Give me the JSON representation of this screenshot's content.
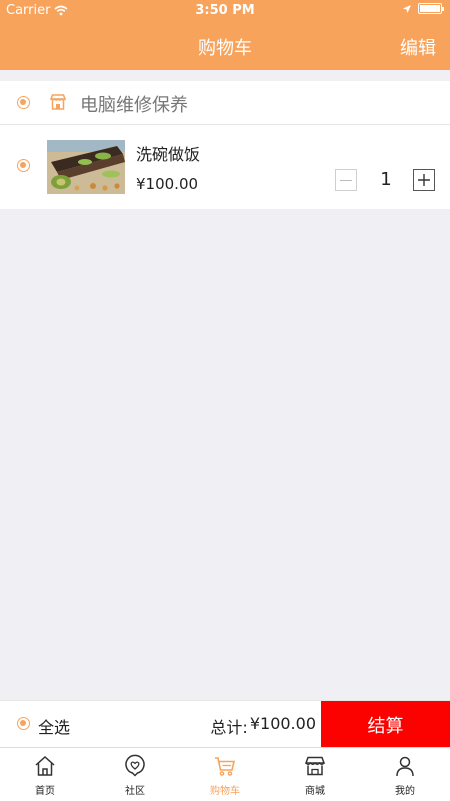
{
  "colors": {
    "accent": "#f7a35c",
    "checkout": "#fb0200",
    "background": "#efeff4"
  },
  "status_bar": {
    "carrier": "Carrier",
    "time": "3:50 PM"
  },
  "nav": {
    "title": "购物车",
    "edit_label": "编辑"
  },
  "store": {
    "name": "电脑维修保养",
    "icon": "store-icon",
    "selected": true
  },
  "item": {
    "name": "洗碗做饭",
    "price": "¥100.00",
    "quantity": "1",
    "selected": true
  },
  "footer": {
    "select_all_label": "全选",
    "total_label": "总计:",
    "total_value": "¥100.00",
    "checkout_label": "结算"
  },
  "tabs": [
    {
      "label": "首页",
      "icon": "home-icon"
    },
    {
      "label": "社区",
      "icon": "heart-chat-icon"
    },
    {
      "label": "购物车",
      "icon": "cart-icon",
      "active": true
    },
    {
      "label": "商城",
      "icon": "shop-icon"
    },
    {
      "label": "我的",
      "icon": "user-icon"
    }
  ]
}
